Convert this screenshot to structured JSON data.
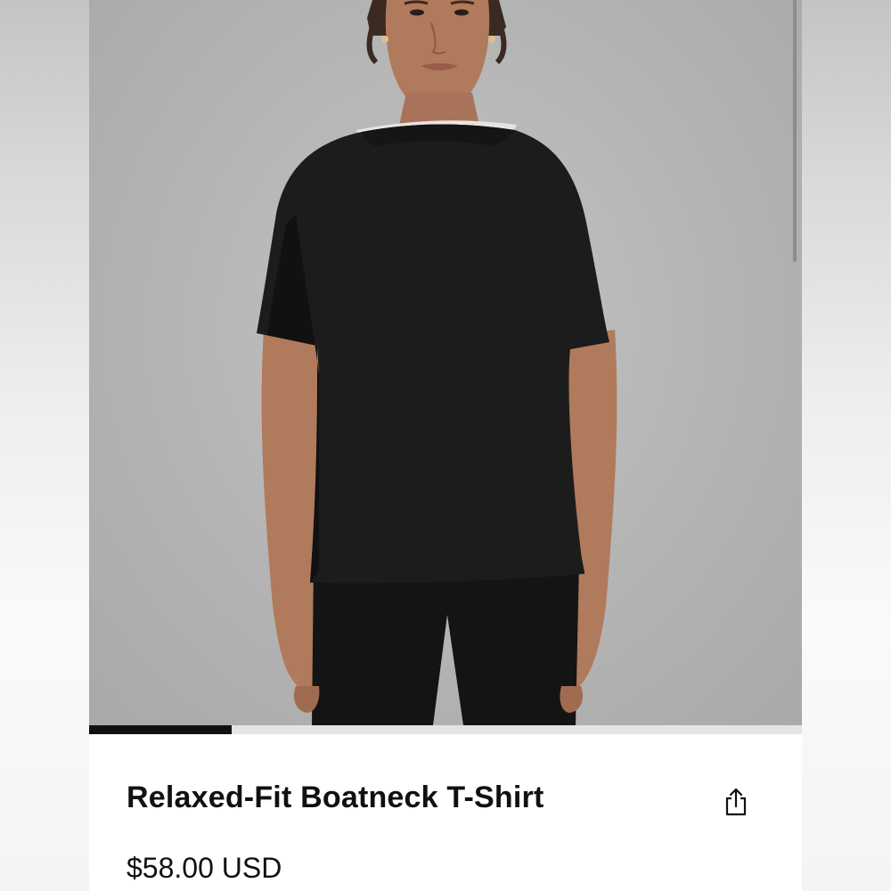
{
  "product": {
    "title": "Relaxed-Fit Boatneck T-Shirt",
    "price": "$58.00 USD",
    "image_alt": "Model wearing a black relaxed-fit boatneck t-shirt with black leggings"
  },
  "carousel": {
    "progress_fraction": 0.2
  },
  "icons": {
    "share": "share-icon"
  },
  "colors": {
    "text": "#111111",
    "shirt": "#1c1c1c",
    "background_gray": "#b4b4b4",
    "progress_fill": "#111111",
    "progress_track": "#e4e4e4"
  }
}
